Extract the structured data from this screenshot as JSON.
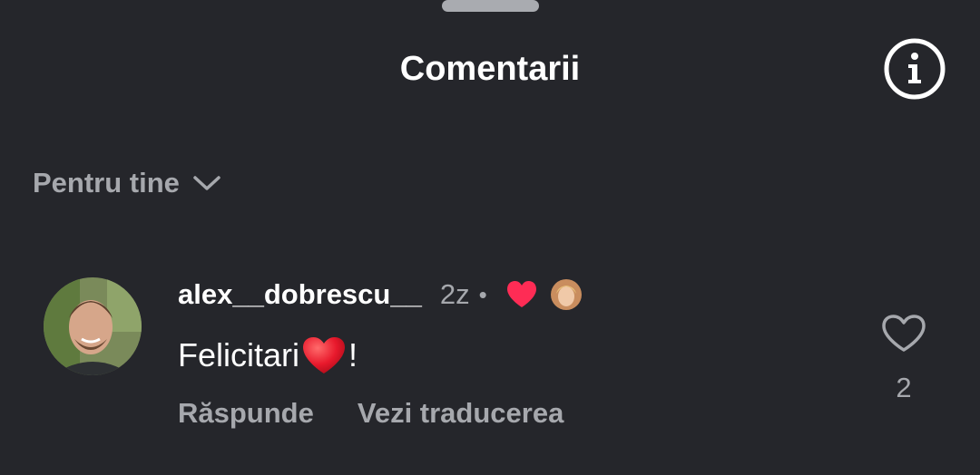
{
  "header": {
    "title": "Comentarii",
    "info_icon": "info-icon"
  },
  "filter": {
    "label": "Pentru tine",
    "icon": "chevron-down-icon"
  },
  "comments": [
    {
      "username": "alex__dobrescu__",
      "time": "2z",
      "separator": "•",
      "text_before_emoji": "Felicitari",
      "text_emoji": "heart-emoji",
      "text_after_emoji": "!",
      "reply_label": "Răspunde",
      "translate_label": "Vezi traducerea",
      "like_count": "2",
      "liked_by_creator": true
    }
  ],
  "colors": {
    "background": "#25262b",
    "text_primary": "#ffffff",
    "text_secondary": "#a6a8ad",
    "heart_red": "#fe2c55"
  }
}
